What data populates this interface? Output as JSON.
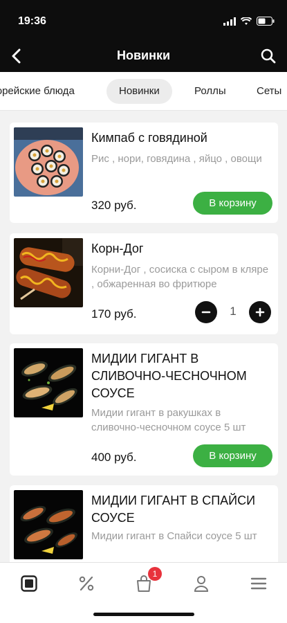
{
  "status_bar": {
    "time": "19:36"
  },
  "header": {
    "title": "Новинки"
  },
  "tabs": [
    {
      "label": "Корейские блюда"
    },
    {
      "label": "Новинки",
      "active": true
    },
    {
      "label": "Роллы"
    },
    {
      "label": "Сеты"
    }
  ],
  "products": [
    {
      "name": "Кимпаб с говядиной",
      "description": "Рис , нори, говядина , яйцо , овощи",
      "price": "320 руб.",
      "action": "В корзину"
    },
    {
      "name": "Корн-Дог",
      "description": "Корни-Дог , сосиска с сыром в кляре , обжаренная во фритюре",
      "price": "170 руб.",
      "quantity": "1"
    },
    {
      "name": "МИДИИ ГИГАНТ В СЛИВОЧНО-ЧЕСНОЧНОМ СОУСЕ",
      "description": "Мидии гигант в ракушках в сливочно-чесночном соусе 5 шт",
      "price": "400 руб.",
      "action": "В корзину"
    },
    {
      "name": "МИДИИ ГИГАНТ В СПАЙСИ СОУСЕ",
      "description": "Мидии гигант в Спайси соусе 5 шт"
    }
  ],
  "bottom_nav": {
    "items": [
      "menu-icon",
      "discount-icon",
      "cart-icon",
      "profile-icon",
      "hamburger-icon"
    ],
    "cart_badge": "1"
  },
  "colors": {
    "accent": "#3cb043",
    "badge": "#e8323c",
    "header_bg": "#0d0d0d"
  }
}
